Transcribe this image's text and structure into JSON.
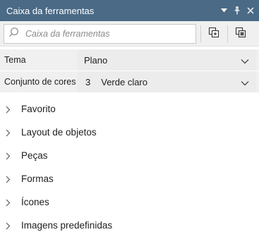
{
  "window": {
    "title": "Caixa da ferramentas"
  },
  "search": {
    "placeholder": "Caixa da ferramentas"
  },
  "properties": {
    "theme_label": "Tema",
    "theme_value": "Plano",
    "colorset_label": "Conjunto de cores",
    "colorset_number": "3",
    "colorset_value": "Verde claro"
  },
  "categories": [
    {
      "label": "Favorito"
    },
    {
      "label": "Layout de objetos"
    },
    {
      "label": "Peças"
    },
    {
      "label": "Formas"
    },
    {
      "label": "Ícones"
    },
    {
      "label": "Imagens predefinidas"
    }
  ],
  "icons": {
    "dropdown": "chevron-down-icon",
    "pin": "pin-icon",
    "close": "close-icon",
    "search": "search-icon",
    "expand": "chevron-right-icon"
  },
  "colors": {
    "titlebar": "#4a6a86",
    "panel": "#f0f0f0",
    "accent": "#1e1e1e"
  }
}
